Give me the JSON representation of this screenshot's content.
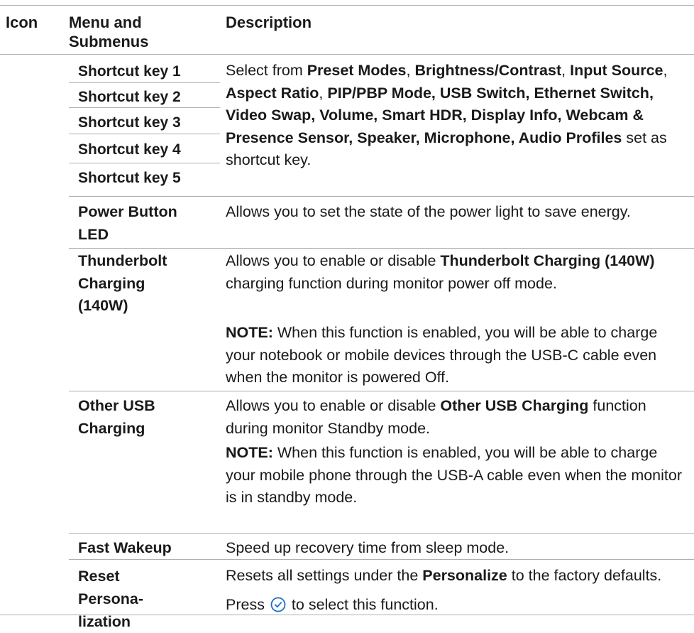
{
  "header": {
    "col_icon": "Icon",
    "col_menu_line1": "Menu and",
    "col_menu_line2": "Submenus",
    "col_desc": "Description"
  },
  "shortcut_keys": [
    "Shortcut  key 1",
    "Shortcut  key 2",
    "Shortcut  key 3",
    "Shortcut  key 4",
    "Shortcut  key 5"
  ],
  "shortcut_desc": {
    "t1": "Select from ",
    "b1": "Preset Modes",
    "t2": ", ",
    "b2": "Brightness/Contrast",
    "t3": ", ",
    "b3": "Input Source",
    "t4": ", ",
    "b4": "Aspect Ratio",
    "t5": ", ",
    "b5": "PIP/PBP Mode, USB Switch, Ethernet Switch, Video Swap, Volume, Smart HDR, Display Info, Webcam & Presence Sensor, Speaker, Microphone, Audio Profiles",
    "t6": " set as shortcut key."
  },
  "power_led": {
    "label_line1": "Power Button",
    "label_line2": "LED",
    "desc": "Allows you to set the state of the power light to save energy."
  },
  "tb_charging": {
    "label_line1": "Thunderbolt",
    "label_line2": "Charging",
    "label_line3": "(140W)",
    "desc_pre": "Allows you to enable or disable ",
    "desc_bold": "Thunderbolt Charging (140W)",
    "desc_post": " charging function during monitor power off mode.",
    "note_label": "NOTE:",
    "note_text": " When this function is enabled, you will be able to charge your notebook or mobile devices through the USB-C cable even when the monitor is powered Off."
  },
  "usb_charging": {
    "label_line1": "Other USB",
    "label_line2": "Charging",
    "desc_pre": "Allows you to enable or disable ",
    "desc_bold": "Other USB Charging",
    "desc_post": " function during monitor Standby mode.",
    "note_label": "NOTE:",
    "note_text": " When this function is enabled, you will be able to charge your mobile phone through the USB-A cable even when the monitor is in standby mode."
  },
  "fast_wakeup": {
    "label": "Fast Wakeup",
    "desc": "Speed up recovery time from sleep mode."
  },
  "reset_personalization": {
    "label_line1": "Reset",
    "label_line2": "Persona-",
    "label_line3": "lization",
    "desc_pre": "Resets all settings under the ",
    "desc_bold": "Personalize",
    "desc_post": " to the factory defaults.",
    "press_pre": "Press ",
    "press_post": " to select this function",
    "press_end": "."
  },
  "colors": {
    "rule": "#b0b0b0",
    "text": "#1a1a1a",
    "icon_blue": "#1a6fc9"
  },
  "icons": {
    "select": "check-circle-icon"
  }
}
